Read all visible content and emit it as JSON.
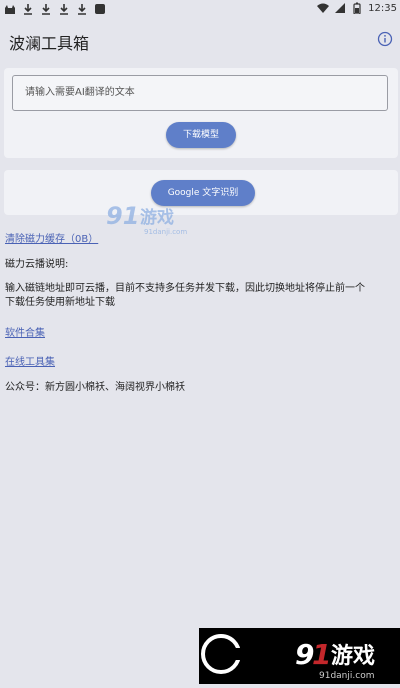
{
  "status_bar": {
    "time": "12:35",
    "left_icons": [
      "cat-icon",
      "download-icon",
      "download-icon",
      "download-icon",
      "download-icon",
      "square-icon"
    ],
    "right_icons": [
      "wifi-icon",
      "signal-icon",
      "battery-icon"
    ]
  },
  "app": {
    "title": "波澜工具箱",
    "info_icon": "info-icon"
  },
  "translate": {
    "input_placeholder": "请输入需要AI翻译的文本",
    "download_button": "下载模型"
  },
  "ocr": {
    "button": "Google 文字识别"
  },
  "links": {
    "clear_cache": "清除磁力缓存（0B）",
    "software": "软件合集",
    "online_tools": "在线工具集"
  },
  "magnet": {
    "heading": "磁力云播说明:",
    "line1": "输入磁链地址即可云播，目前不支持多任务并发下载，因此切换地址将停止前一个",
    "line2": "下载任务使用新地址下载"
  },
  "wechat": "公众号：新方圆小棉袄、海阔视界小棉袄",
  "watermark": {
    "brand": "91游戏",
    "url": "91danji.com",
    "accent": "#c3272b"
  },
  "colors": {
    "accent": "#5f7fc9",
    "link": "#4a62b5",
    "background": "#e4e5ec"
  }
}
